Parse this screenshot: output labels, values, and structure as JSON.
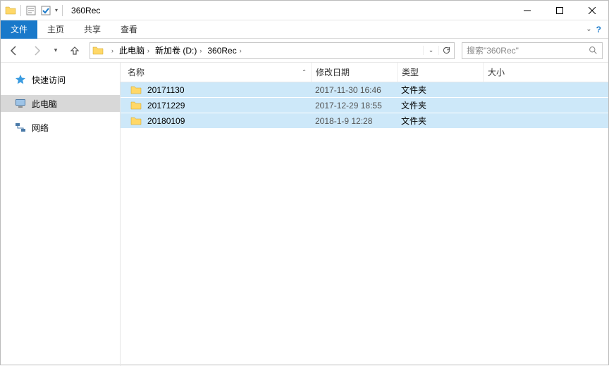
{
  "titlebar": {
    "title": "360Rec"
  },
  "ribbon": {
    "file": "文件",
    "home": "主页",
    "share": "共享",
    "view": "查看"
  },
  "breadcrumbs": {
    "root": "此电脑",
    "drive": "新加卷 (D:)",
    "folder": "360Rec"
  },
  "search": {
    "placeholder": "搜索\"360Rec\""
  },
  "sidebar": {
    "quick": "快速访问",
    "thispc": "此电脑",
    "network": "网络"
  },
  "columns": {
    "name": "名称",
    "date": "修改日期",
    "type": "类型",
    "size": "大小"
  },
  "rows": [
    {
      "name": "20171130",
      "date": "2017-11-30 16:46",
      "type": "文件夹",
      "size": ""
    },
    {
      "name": "20171229",
      "date": "2017-12-29 18:55",
      "type": "文件夹",
      "size": ""
    },
    {
      "name": "20180109",
      "date": "2018-1-9 12:28",
      "type": "文件夹",
      "size": ""
    }
  ]
}
